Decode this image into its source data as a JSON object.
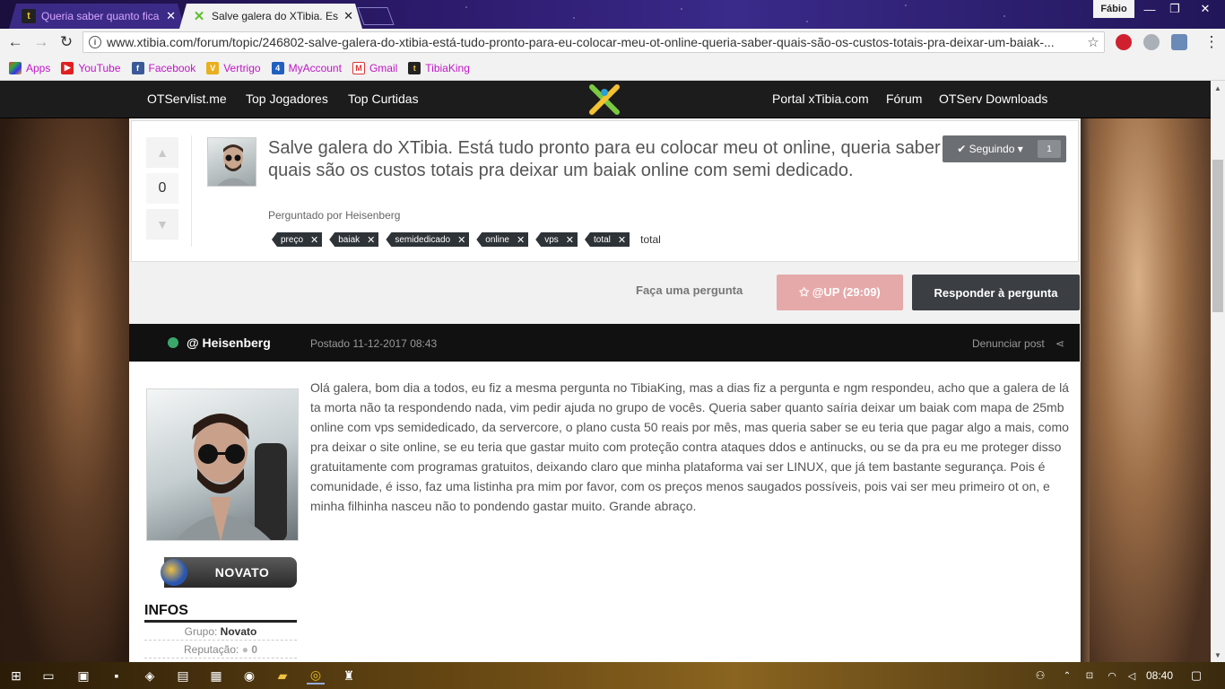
{
  "browser": {
    "tabs": [
      {
        "title": "Queria saber quanto fica",
        "active": false
      },
      {
        "title": "Salve galera do XTibia. Es",
        "active": true
      }
    ],
    "profile_name": "Fábio",
    "url": "www.xtibia.com/forum/topic/246802-salve-galera-do-xtibia-está-tudo-pronto-para-eu-colocar-meu-ot-online-queria-saber-quais-são-os-custos-totais-pra-deixar-um-baiak-...",
    "bookmarks": [
      "Apps",
      "YouTube",
      "Facebook",
      "Vertrigo",
      "MyAccount",
      "Gmail",
      "TibiaKing"
    ]
  },
  "site_nav": {
    "left": [
      "OTServlist.me",
      "Top Jogadores",
      "Top Curtidas"
    ],
    "right": [
      "Portal xTibia.com",
      "Fórum",
      "OTServ Downloads"
    ]
  },
  "question": {
    "votes": "0",
    "title": "Salve galera do XTibia. Está tudo pronto para eu colocar meu ot online, queria saber quais são os custos totais pra deixar um baiak online com semi dedicado.",
    "asked_by": "Perguntado por Heisenberg",
    "tags": [
      "preço",
      "baiak",
      "semidedicado",
      "online",
      "vps",
      "total"
    ],
    "tag_input": "total",
    "follow_label": "✔ Seguindo ▾",
    "follow_count": "1"
  },
  "actions": {
    "ask": "Faça uma pergunta",
    "up": "✩ @UP (29:09)",
    "answer": "Responder à pergunta"
  },
  "post": {
    "author": "@ Heisenberg",
    "date": "Postado 11-12-2017 08:43",
    "report": "Denunciar post",
    "rank": "NOVATO",
    "infos_header": "INFOS",
    "grupo_label": "Grupo:",
    "grupo_value": "Novato",
    "reputacao_label": "Reputação:",
    "reputacao_value": "0",
    "body": "Olá galera, bom dia a todos, eu fiz a mesma pergunta no TibiaKing, mas a dias fiz a pergunta e ngm respondeu, acho que a galera de lá ta morta não ta respondendo nada, vim pedir ajuda no grupo de vocês. Queria saber quanto saíria deixar um baiak com mapa de 25mb online com vps semidedicado, da servercore, o plano custa 50 reais por mês, mas queria saber se eu teria que pagar algo a mais, como pra deixar o site online, se eu teria que gastar muito com proteção contra ataques ddos e antinucks, ou se da pra eu me proteger disso gratuitamente com programas gratuitos, deixando claro que minha plataforma vai ser LINUX, que já tem bastante segurança. Pois é comunidade, é isso, faz uma listinha pra mim por favor, com os preços menos saugados possíveis, pois vai ser meu primeiro ot on, e minha filhinha nasceu não to pondendo gastar muito. Grande abraço."
  },
  "taskbar": {
    "time": "08:40"
  },
  "colors": {
    "follow_bg": "#6b6f73",
    "up_bg": "#e6a9a9",
    "answer_bg": "#3b3f44",
    "online_dot": "#3aa86a",
    "bookmark_text": "#c016c6"
  }
}
